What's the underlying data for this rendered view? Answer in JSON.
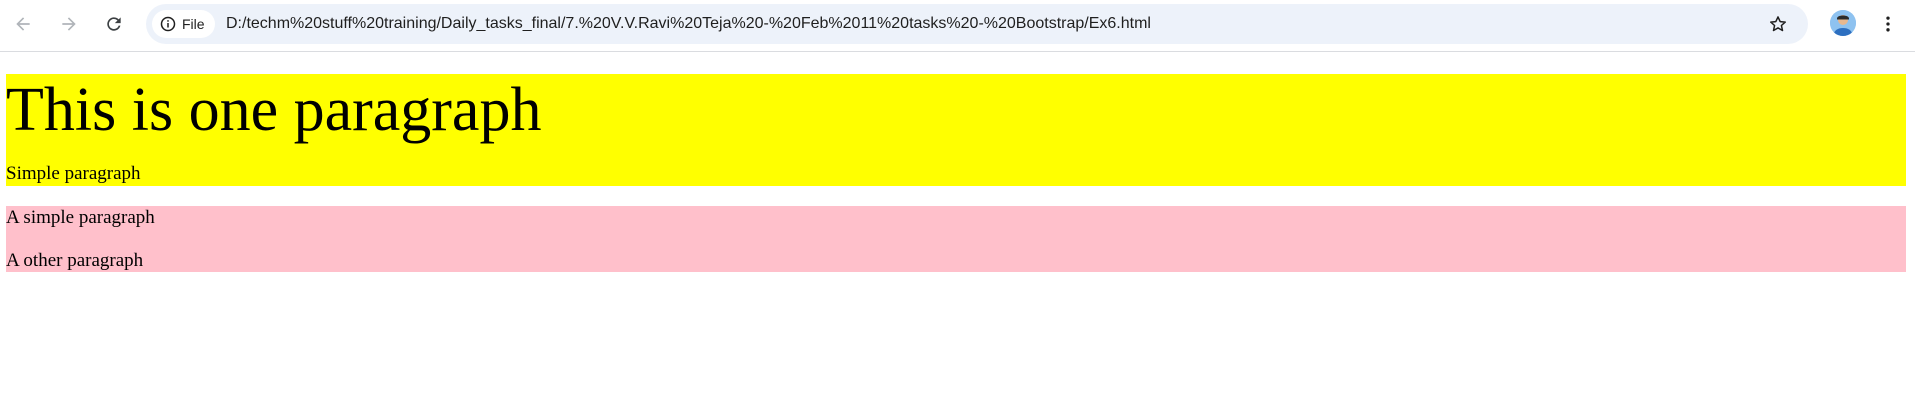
{
  "browser": {
    "back_icon": "arrow-left-icon",
    "forward_icon": "arrow-right-icon",
    "reload_icon": "reload-icon",
    "site_info_label": "File",
    "site_info_icon": "info-icon",
    "url": "D:/techm%20stuff%20training/Daily_tasks_final/7.%20V.V.Ravi%20Teja%20-%20Feb%2011%20tasks%20-%20Bootstrap/Ex6.html",
    "bookmark_icon": "star-icon",
    "profile_icon": "avatar",
    "menu_icon": "three-dots-icon"
  },
  "page": {
    "yellow_section": {
      "background": "#ffff00",
      "heading": "This is one paragraph",
      "paragraph": "Simple paragraph"
    },
    "pink_section": {
      "background": "#ffc0cb",
      "paragraphs": [
        "A simple paragraph",
        "A other paragraph"
      ]
    }
  }
}
